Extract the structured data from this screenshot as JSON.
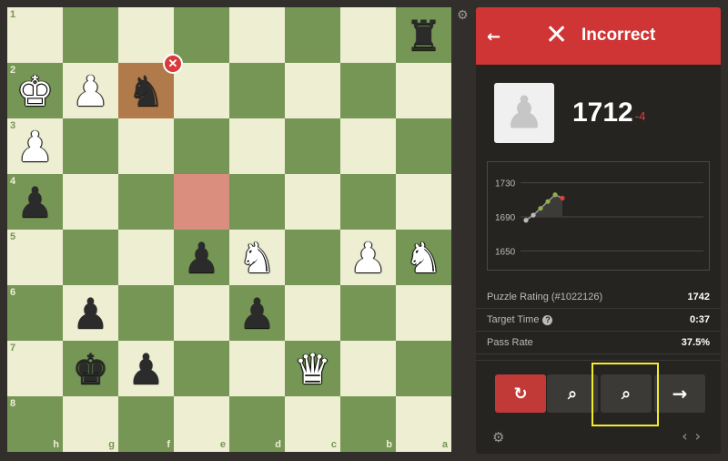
{
  "board": {
    "ranks": [
      "1",
      "2",
      "3",
      "4",
      "5",
      "6",
      "7",
      "8"
    ],
    "files": [
      "h",
      "g",
      "f",
      "e",
      "d",
      "c",
      "b",
      "a"
    ],
    "pieces": [
      {
        "sq": "a1",
        "glyph": "♜",
        "color": "b",
        "name": "black-rook"
      },
      {
        "sq": "h2",
        "glyph": "♚",
        "color": "w",
        "name": "white-king"
      },
      {
        "sq": "g2",
        "glyph": "♟",
        "color": "w",
        "name": "white-pawn"
      },
      {
        "sq": "f2",
        "glyph": "♞",
        "color": "b",
        "name": "black-knight"
      },
      {
        "sq": "h3",
        "glyph": "♟",
        "color": "w",
        "name": "white-pawn"
      },
      {
        "sq": "h4",
        "glyph": "♟",
        "color": "b",
        "name": "black-pawn"
      },
      {
        "sq": "e5",
        "glyph": "♟",
        "color": "b",
        "name": "black-pawn"
      },
      {
        "sq": "d5",
        "glyph": "♞",
        "color": "w",
        "name": "white-knight"
      },
      {
        "sq": "b5",
        "glyph": "♟",
        "color": "w",
        "name": "white-pawn"
      },
      {
        "sq": "a5",
        "glyph": "♞",
        "color": "w",
        "name": "white-knight"
      },
      {
        "sq": "g6",
        "glyph": "♟",
        "color": "b",
        "name": "black-pawn"
      },
      {
        "sq": "d6",
        "glyph": "♟",
        "color": "b",
        "name": "black-pawn"
      },
      {
        "sq": "g7",
        "glyph": "♚",
        "color": "b",
        "name": "black-king"
      },
      {
        "sq": "f7",
        "glyph": "♟",
        "color": "b",
        "name": "black-pawn"
      },
      {
        "sq": "c7",
        "glyph": "♛",
        "color": "w",
        "name": "white-queen"
      }
    ],
    "highlight_from": "e4",
    "highlight_to": "f2",
    "wrong_move_icon": "✕"
  },
  "settings_icon": "⚙",
  "panel": {
    "back_icon": "←",
    "result_icon": "✕",
    "result_title": "Incorrect",
    "avatar_icon": "♟",
    "rating": "1712",
    "rating_delta": "-4",
    "colors": {
      "header": "#cf3535",
      "delta": "#e03e3e",
      "focus": "#f4ec2a"
    }
  },
  "chart_data": {
    "type": "line",
    "y_ticks": [
      "1730",
      "1690",
      "1650"
    ],
    "ylim": [
      1630,
      1750
    ],
    "series": [
      {
        "values": [
          1686,
          1692,
          1700,
          1708,
          1716,
          1712
        ]
      }
    ]
  },
  "stats": {
    "puzzle_rating_label": "Puzzle Rating (#1022126)",
    "puzzle_rating_value": "1742",
    "target_time_label": "Target Time",
    "target_time_help": "?",
    "target_time_value": "0:37",
    "pass_rate_label": "Pass Rate",
    "pass_rate_value": "37.5%"
  },
  "controls": {
    "retry_icon": "↻",
    "hint_icon": "⌕",
    "analyze_icon": "⌕",
    "next_icon": "→",
    "footer_settings_icon": "⚙",
    "prev_icon": "‹",
    "next_page_icon": "›"
  }
}
